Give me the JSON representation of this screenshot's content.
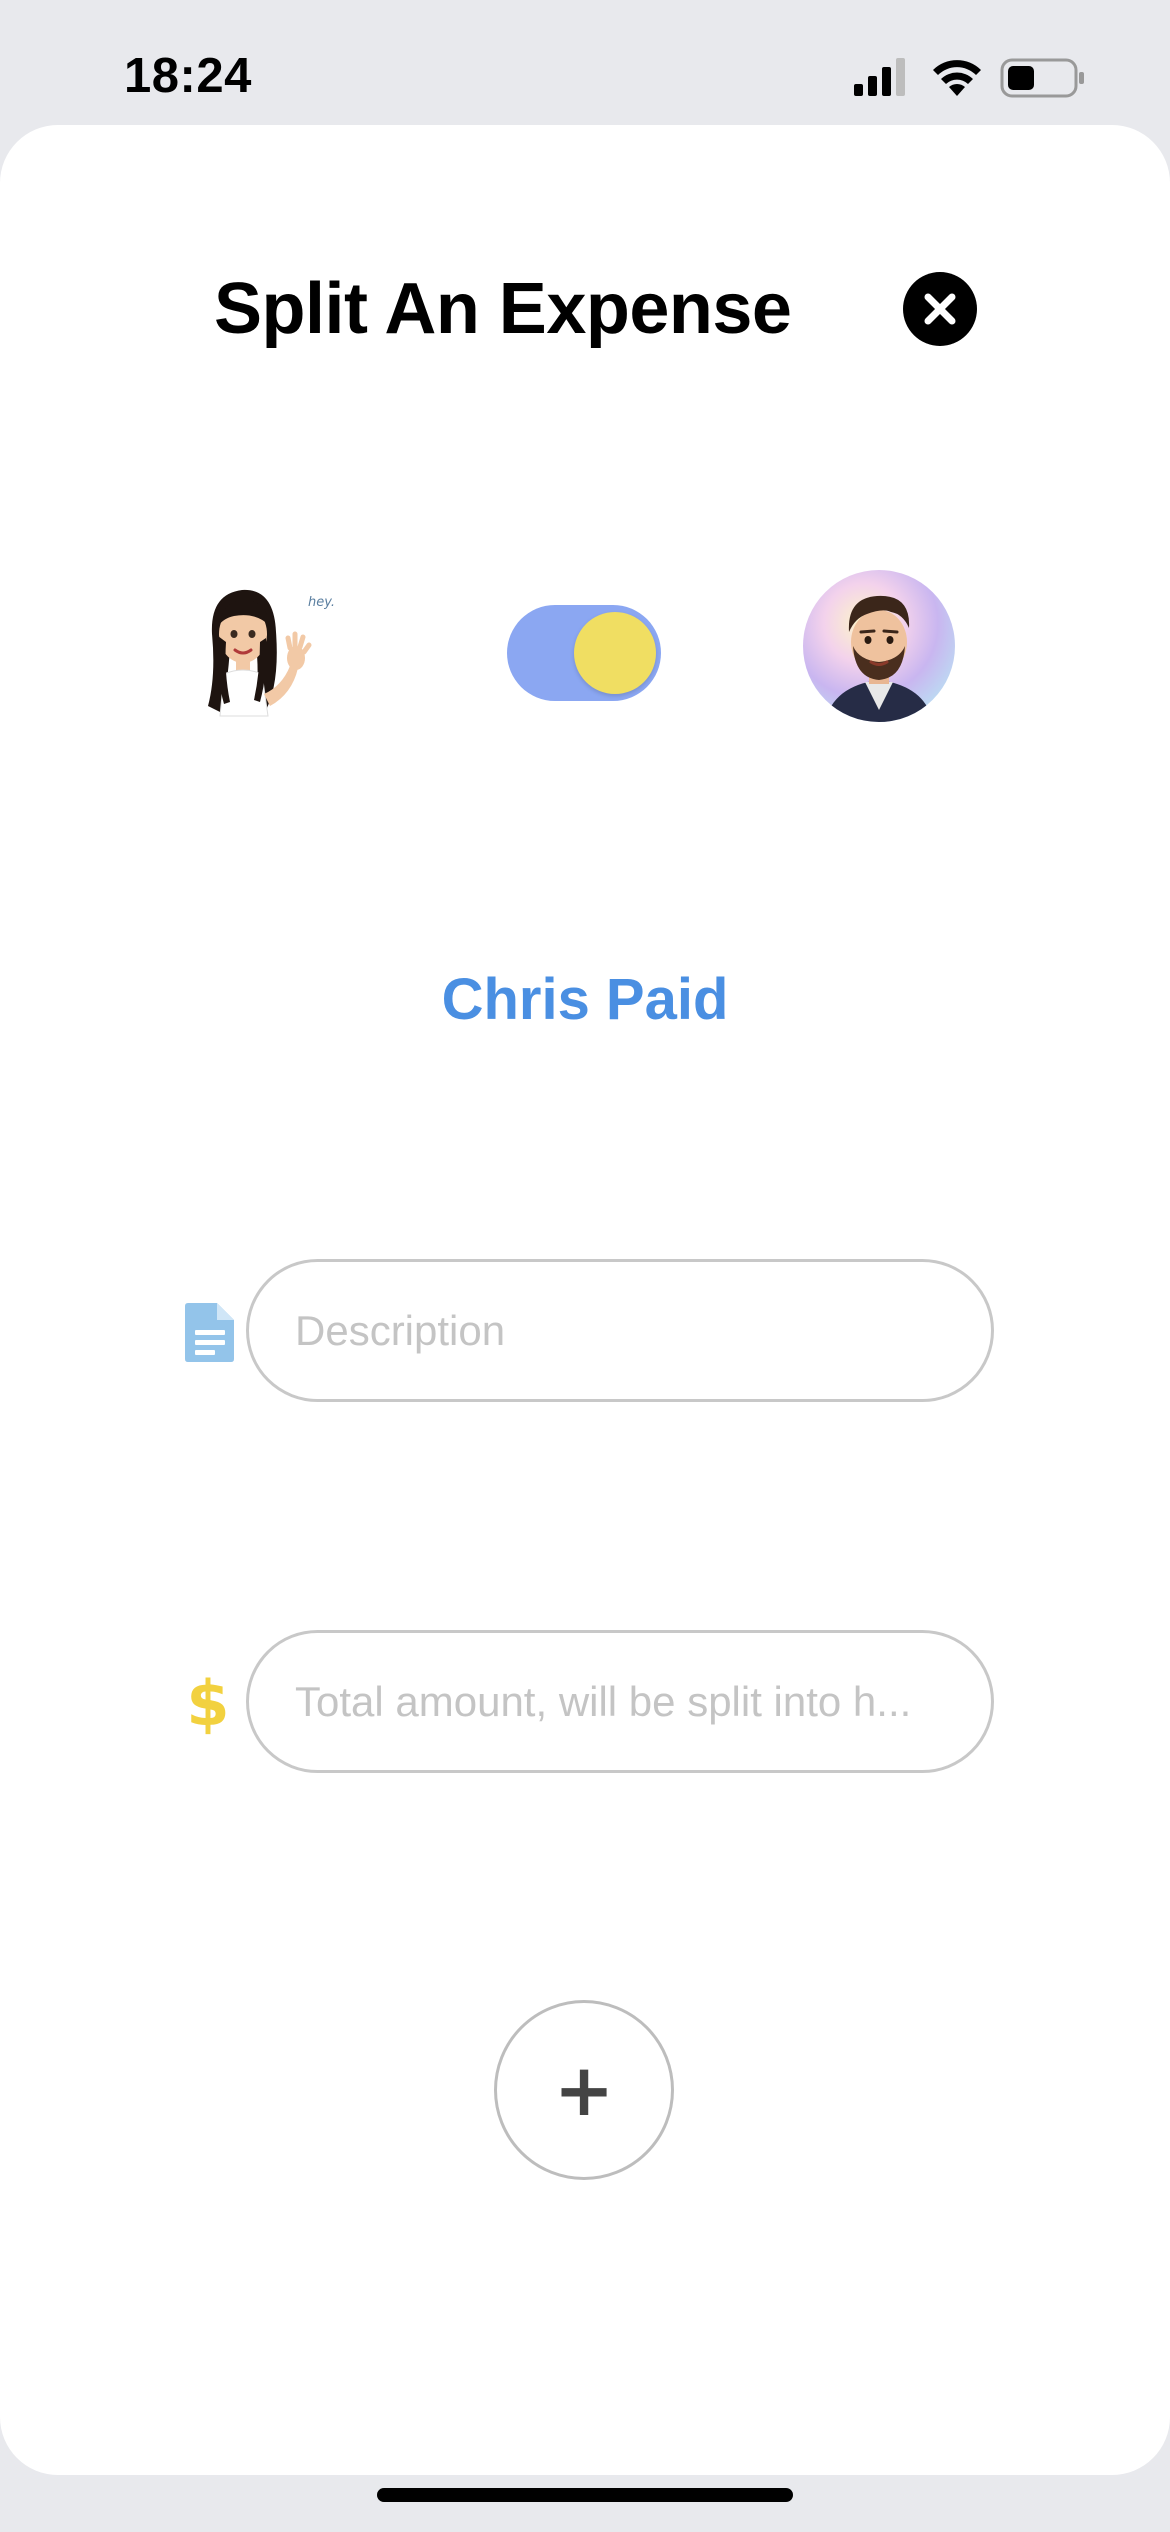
{
  "status_bar": {
    "time": "18:24",
    "icons": [
      "cellular-signal-icon",
      "wifi-icon",
      "battery-icon"
    ]
  },
  "sheet": {
    "title": "Split An Expense",
    "close_icon": "close-icon"
  },
  "payer_switch": {
    "left_avatar": "female-memoji-avatar",
    "left_avatar_caption": "hey.",
    "right_avatar": "male-memoji-avatar",
    "toggle_on": true,
    "toggle_track_color": "#8ba7f2",
    "toggle_knob_color": "#f0de62",
    "payer_label": "Chris Paid",
    "payer_label_color": "#4a8fe2"
  },
  "form": {
    "description": {
      "icon": "document-icon",
      "placeholder": "Description",
      "value": ""
    },
    "amount": {
      "icon": "dollar-icon",
      "placeholder": "Total amount, will be split into h...",
      "value": ""
    },
    "add_button_label": "+"
  }
}
